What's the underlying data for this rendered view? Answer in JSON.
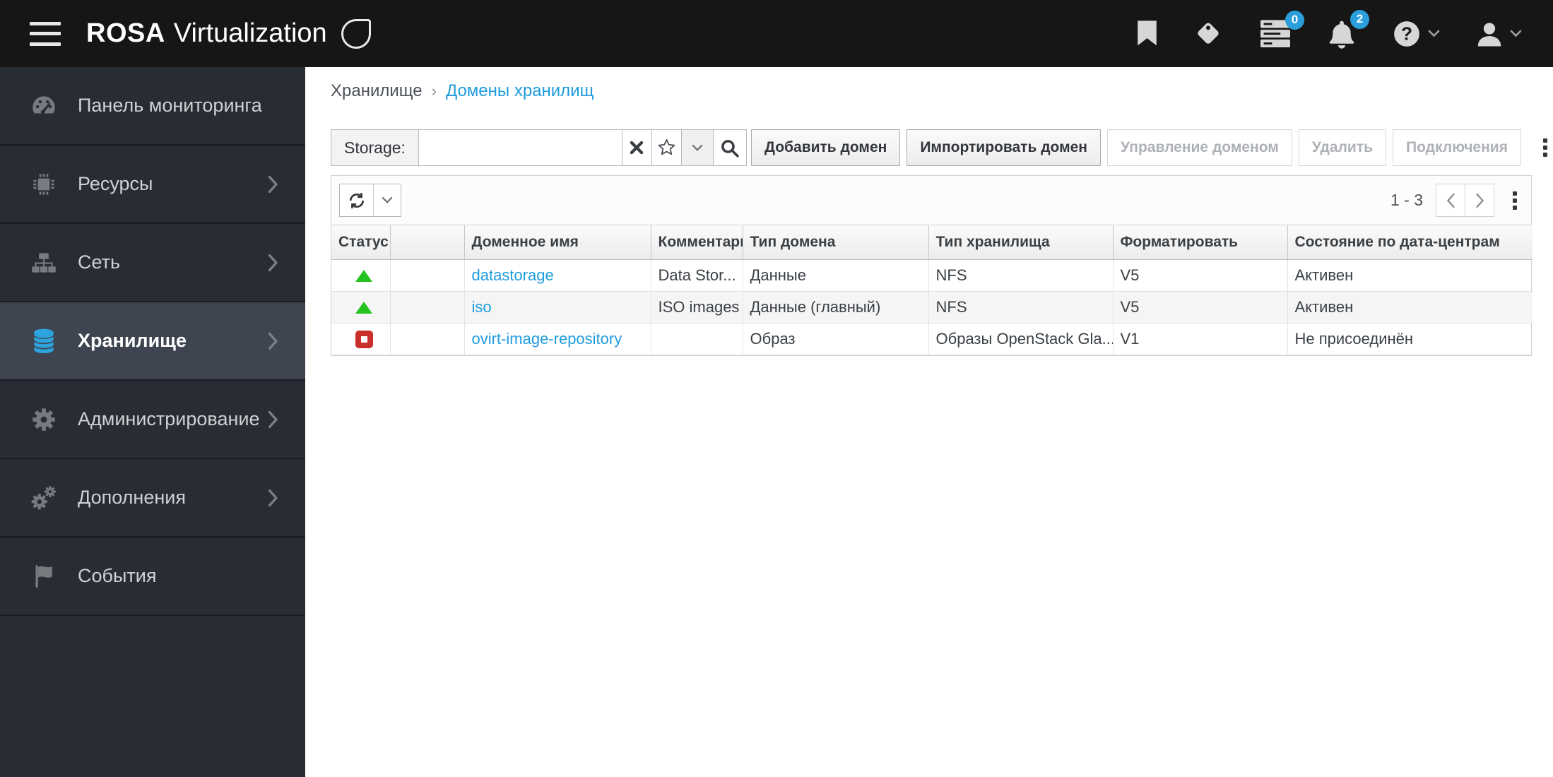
{
  "header": {
    "brand_bold": "ROSA",
    "brand_rest": "Virtualization",
    "tasks_badge": "0",
    "alerts_badge": "2"
  },
  "sidebar": {
    "items": [
      {
        "id": "dashboard",
        "label": "Панель мониторинга",
        "icon": "dashboard-icon",
        "chevron": false,
        "active": false
      },
      {
        "id": "resources",
        "label": "Ресурсы",
        "icon": "cpu-icon",
        "chevron": true,
        "active": false
      },
      {
        "id": "network",
        "label": "Сеть",
        "icon": "network-icon",
        "chevron": true,
        "active": false
      },
      {
        "id": "storage",
        "label": "Хранилище",
        "icon": "database-icon",
        "chevron": true,
        "active": true
      },
      {
        "id": "administration",
        "label": "Администрирование",
        "icon": "gear-icon",
        "chevron": true,
        "active": false
      },
      {
        "id": "addons",
        "label": "Дополнения",
        "icon": "gears-icon",
        "chevron": true,
        "active": false
      },
      {
        "id": "events",
        "label": "События",
        "icon": "flag-icon",
        "chevron": false,
        "active": false
      }
    ]
  },
  "breadcrumb": {
    "parent": "Хранилище",
    "separator": "›",
    "current": "Домены хранилищ"
  },
  "filter": {
    "label": "Storage:",
    "value": ""
  },
  "actions": [
    {
      "id": "add-domain",
      "label": "Добавить домен",
      "enabled": true
    },
    {
      "id": "import-domain",
      "label": "Импортировать домен",
      "enabled": true
    },
    {
      "id": "manage-domain",
      "label": "Управление доменом",
      "enabled": false
    },
    {
      "id": "remove",
      "label": "Удалить",
      "enabled": false
    },
    {
      "id": "connections",
      "label": "Подключения",
      "enabled": false
    }
  ],
  "toolbar": {
    "range": "1 - 3"
  },
  "table": {
    "columns": [
      "Статус",
      "",
      "Доменное имя",
      "Комментарий",
      "Тип домена",
      "Тип хранилища",
      "Форматировать",
      "Состояние по дата-центрам"
    ],
    "rows": [
      {
        "status": "up",
        "name": "datastorage",
        "comment": "Data Stor...",
        "domain_type": "Данные",
        "storage_type": "NFS",
        "format": "V5",
        "state": "Активен"
      },
      {
        "status": "up",
        "name": "iso",
        "comment": "ISO images",
        "domain_type": "Данные (главный)",
        "storage_type": "NFS",
        "format": "V5",
        "state": "Активен"
      },
      {
        "status": "down",
        "name": "ovirt-image-repository",
        "comment": "",
        "domain_type": "Образ",
        "storage_type": "Образы OpenStack Gla...",
        "format": "V1",
        "state": "Не присоединён"
      }
    ]
  },
  "colors": {
    "accent_blue": "#1f9cdd",
    "badge_blue": "#2b9fdc",
    "status_up_green": "#25c31f",
    "status_down_red": "#c9302c",
    "header_bg": "#161616",
    "sidebar_bg": "#282d35"
  }
}
